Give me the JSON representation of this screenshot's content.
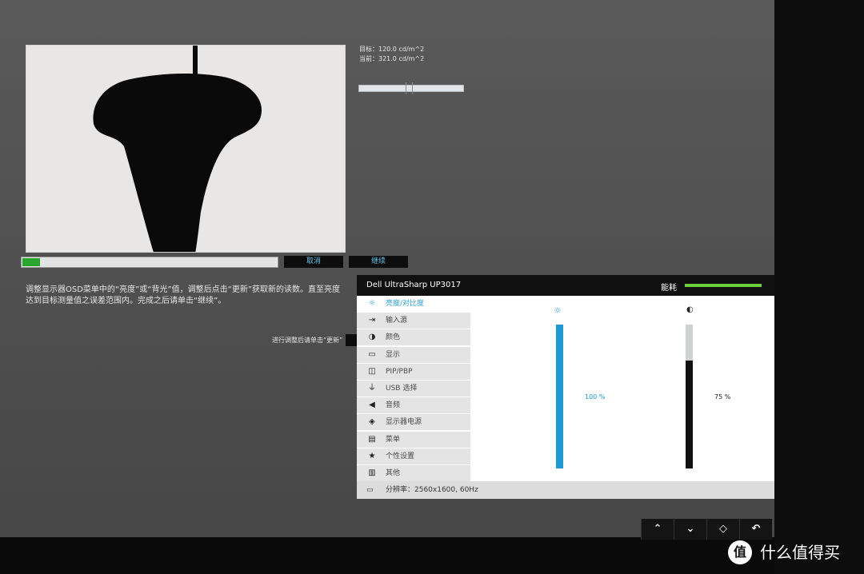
{
  "calibration": {
    "target": "目标：120.0 cd/m^2",
    "current": "当前：321.0 cd/m^2",
    "progress_fraction": 0.07,
    "cancel_label": "取消",
    "continue_label": "继续",
    "instructions": "调整显示器OSD菜单中的“亮度”或“背光”值，调整后点击“更新”获取新的读数。直至亮度达到目标测量值之误差范围内。完成之后请单击“继续”。",
    "update_hint": "进行调整后请单击“更新”"
  },
  "osd": {
    "model": "Dell UltraSharp UP3017",
    "energy_label": "能耗",
    "menu": [
      {
        "label": "亮度/对比度",
        "icon": "brightness-icon",
        "glyph": "☼",
        "selected": true
      },
      {
        "label": "输入源",
        "icon": "input-source-icon",
        "glyph": "⇥",
        "selected": false
      },
      {
        "label": "颜色",
        "icon": "color-icon",
        "glyph": "◑",
        "selected": false
      },
      {
        "label": "显示",
        "icon": "display-icon",
        "glyph": "▭",
        "selected": false
      },
      {
        "label": "PIP/PBP",
        "icon": "pip-icon",
        "glyph": "◫",
        "selected": false
      },
      {
        "label": "USB 选择",
        "icon": "usb-icon",
        "glyph": "⏚",
        "selected": false
      },
      {
        "label": "音频",
        "icon": "speaker-icon",
        "glyph": "◀",
        "selected": false
      },
      {
        "label": "显示器电源",
        "icon": "power-icon",
        "glyph": "◈",
        "selected": false
      },
      {
        "label": "菜单",
        "icon": "menu-icon",
        "glyph": "▤",
        "selected": false
      },
      {
        "label": "个性设置",
        "icon": "star-icon",
        "glyph": "★",
        "selected": false
      },
      {
        "label": "其他",
        "icon": "other-icon",
        "glyph": "▥",
        "selected": false
      }
    ],
    "brightness": {
      "icon": "sun-icon",
      "glyph": "☼",
      "value_text": "100 %",
      "level": 1.0,
      "color": "#1a9ad6"
    },
    "contrast": {
      "icon": "contrast-icon",
      "glyph": "◐",
      "value_text": "75 %",
      "level": 0.75,
      "color": "#111111"
    },
    "resolution": "分辨率：2560x1600, 60Hz"
  },
  "nav_buttons": [
    {
      "name": "up-arrow-icon",
      "glyph": "⌃"
    },
    {
      "name": "down-arrow-icon",
      "glyph": "⌄"
    },
    {
      "name": "select-icon",
      "glyph": "◇"
    },
    {
      "name": "back-icon",
      "glyph": "↶"
    }
  ],
  "watermark": {
    "logo": "值",
    "text": "什么值得买"
  }
}
